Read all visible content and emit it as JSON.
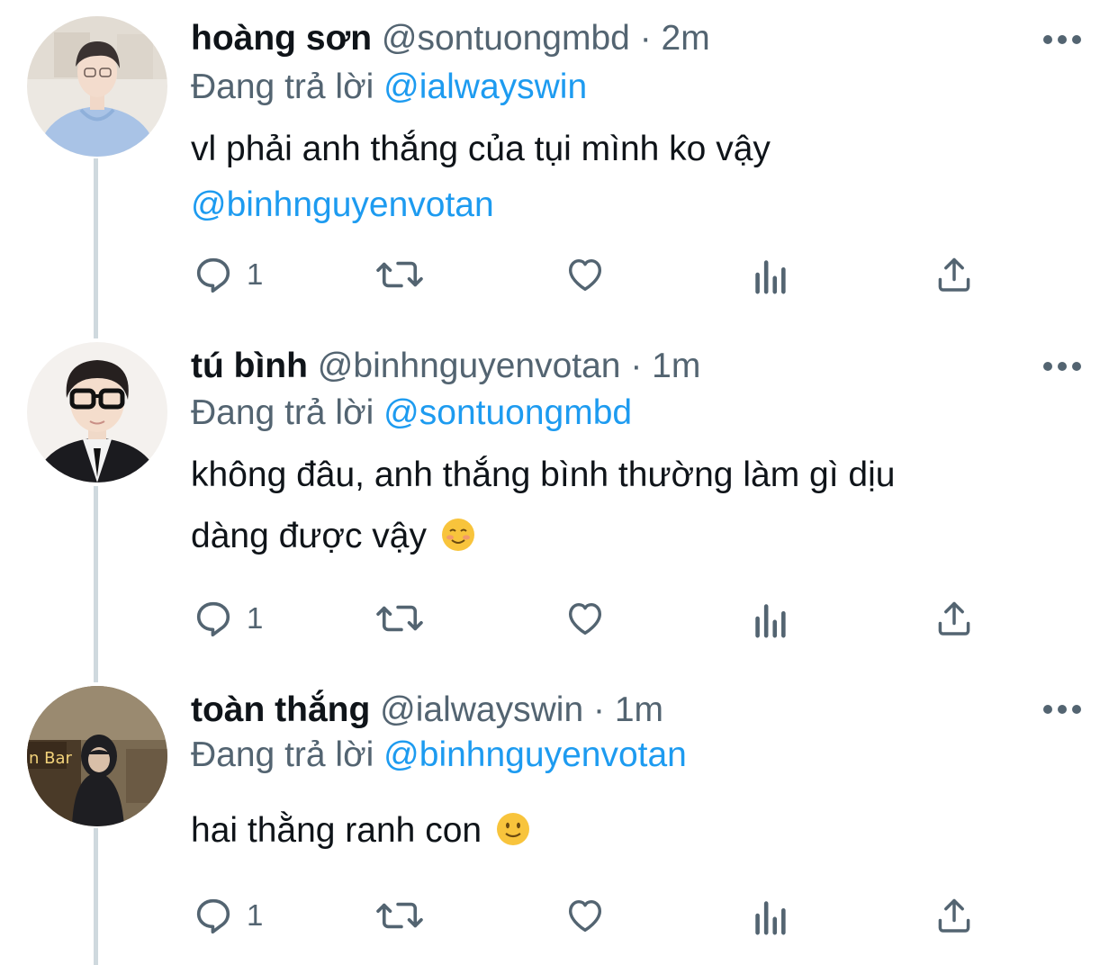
{
  "colors": {
    "accent": "#1d9bf0",
    "secondary_text": "#536471",
    "primary_text": "#0f1419",
    "thread_line": "#cfd9de"
  },
  "tweets": [
    {
      "name": "hoàng sơn",
      "handle": "@sontuongmbd",
      "sep": "·",
      "time": "2m",
      "replying_prefix": "Đang trả lời",
      "replying_to": "@ialwayswin",
      "text_line1": "vl phải anh thắng của tụi mình ko vậy",
      "text_mention": "@binhnguyenvotan",
      "reply_count": "1",
      "avatar_icon": "profile-photo-hoodie"
    },
    {
      "name": "tú bình",
      "handle": "@binhnguyenvotan",
      "sep": "·",
      "time": "1m",
      "replying_prefix": "Đang trả lời",
      "replying_to": "@sontuongmbd",
      "text_line1": "không đâu, anh thắng bình thường làm gì dịu",
      "text_line2": "dàng được vậy",
      "emoji": "smiling-face-emoji",
      "reply_count": "1",
      "avatar_icon": "profile-photo-glasses"
    },
    {
      "name": "toàn thắng",
      "handle": "@ialwayswin",
      "sep": "·",
      "time": "1m",
      "replying_prefix": "Đang trả lời",
      "replying_to": "@binhnguyenvotan",
      "text_line1": "hai thằng ranh con",
      "emoji": "slightly-smiling-face-emoji",
      "reply_count": "1",
      "avatar_icon": "profile-photo-street",
      "avatar_sign_text": "n Bar"
    }
  ],
  "action_icons": [
    "reply-icon",
    "retweet-icon",
    "like-icon",
    "views-icon",
    "share-icon"
  ]
}
